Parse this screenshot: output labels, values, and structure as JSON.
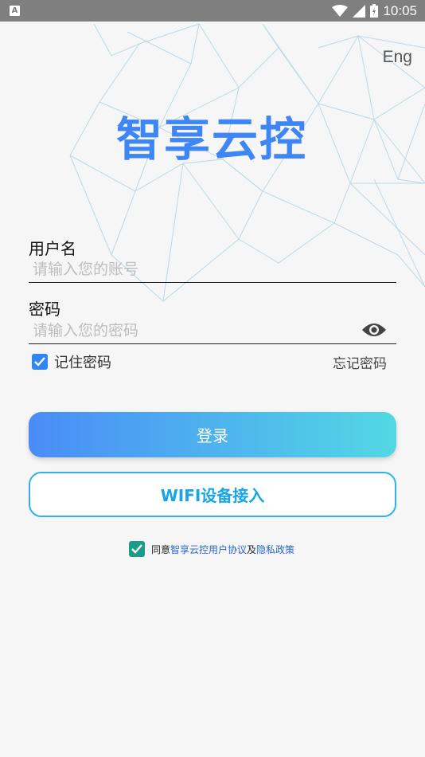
{
  "status_bar": {
    "time": "10:05",
    "notif_icon_letter": "A"
  },
  "header": {
    "language_toggle": "Eng",
    "app_title": "智享云控"
  },
  "form": {
    "username_label": "用户名",
    "username_placeholder": "请输入您的账号",
    "password_label": "密码",
    "password_placeholder": "请输入您的密码",
    "remember_label": "记住密码",
    "remember_checked": true,
    "forgot_label": "忘记密码"
  },
  "actions": {
    "login_label": "登录",
    "wifi_label": "WIFI设备接入"
  },
  "agreement": {
    "checked": true,
    "prefix": "同意",
    "terms_link": "智享云控用户协议",
    "joiner": "及",
    "privacy_link": "隐私政策"
  },
  "colors": {
    "title": "#3e86f5",
    "gradient_start": "#4a8cf7",
    "gradient_end": "#52d8e4",
    "wifi_border": "#2ab4ee",
    "agree_checkbox": "#1b9b88"
  }
}
